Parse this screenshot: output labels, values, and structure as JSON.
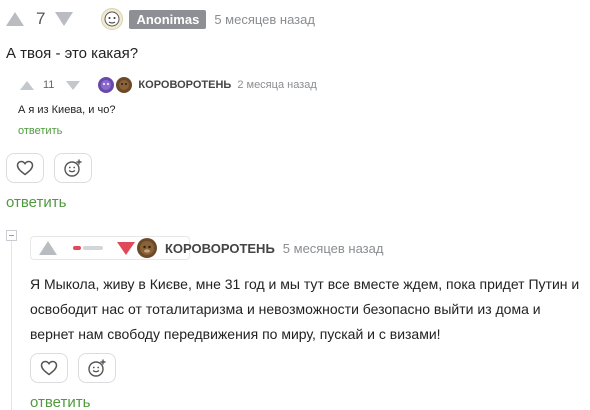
{
  "comment1": {
    "rating": "7",
    "author": "Anonimas",
    "time": "5 месяцев назад",
    "text": "А твоя - это какая?"
  },
  "comment2": {
    "rating": "11",
    "author": "КОРОВОРОТЕНЬ",
    "time": "2 месяца назад",
    "text": "А я из Киева, и чо?",
    "reply_label": "ответить"
  },
  "actions1": {
    "reply_label": "ответить"
  },
  "comment3": {
    "author": "КОРОВОРОТЕНЬ",
    "time": "5 месяцев назад",
    "text": "Я Мыкола, живу в Києве, мне 31 год и мы тут все вместе ждем, пока придет Путин и освободит нас от тоталитаризма и невозможности безопасно выйти из дома и вернет нам свободу передвижения по миру, пускай и с визами!",
    "reply_label": "ответить",
    "balance_negative_fraction": 0.3
  },
  "colors": {
    "reply_green": "#4f9a3f",
    "downvote_red": "#e0495a",
    "muted_grey": "#8a8d91"
  },
  "icons": [
    "upvote-icon",
    "downvote-icon",
    "heart-icon",
    "emoji-add-icon",
    "collapse-icon"
  ]
}
